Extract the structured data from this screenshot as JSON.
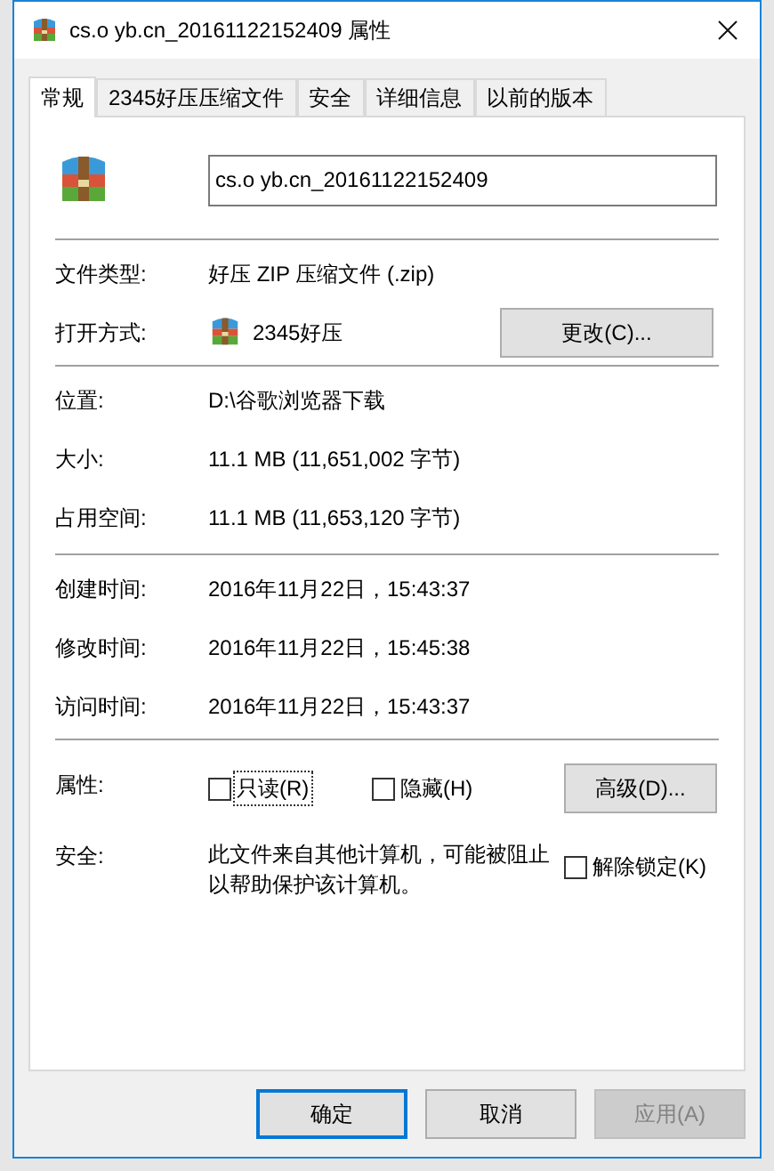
{
  "window": {
    "title": "cs.o yb.cn_20161122152409 属性"
  },
  "tabs": [
    {
      "label": "常规",
      "selected": true
    },
    {
      "label": "2345好压压缩文件",
      "selected": false
    },
    {
      "label": "安全",
      "selected": false
    },
    {
      "label": "详细信息",
      "selected": false
    },
    {
      "label": "以前的版本",
      "selected": false
    }
  ],
  "file_name": {
    "value": "cs.o yb.cn_20161122152409"
  },
  "type_rows": [
    {
      "kind": "text",
      "label": "文件类型:",
      "value": "好压 ZIP 压缩文件 (.zip)"
    },
    {
      "kind": "app",
      "label": "打开方式:",
      "value": "2345好压",
      "button": "更改(C)..."
    }
  ],
  "location_rows": [
    {
      "label": "位置:",
      "value": "D:\\谷歌浏览器下载"
    },
    {
      "label": "大小:",
      "value": "11.1 MB (11,651,002 字节)"
    },
    {
      "label": "占用空间:",
      "value": "11.1 MB (11,653,120 字节)"
    }
  ],
  "time_rows": [
    {
      "label": "创建时间:",
      "value": "2016年11月22日，15:43:37"
    },
    {
      "label": "修改时间:",
      "value": "2016年11月22日，15:45:38"
    },
    {
      "label": "访问时间:",
      "value": "2016年11月22日，15:43:37"
    }
  ],
  "attributes": {
    "label": "属性:",
    "checkboxes": [
      {
        "label": "只读(R)",
        "checked": false,
        "focused": true
      },
      {
        "label": "隐藏(H)",
        "checked": false,
        "focused": false
      }
    ],
    "button": "高级(D)..."
  },
  "security": {
    "label": "安全:",
    "text": "此文件来自其他计算机，可能被阻止以帮助保护该计算机。",
    "checkbox": {
      "label": "解除锁定(K)",
      "checked": false
    }
  },
  "buttons": [
    {
      "label": "确定",
      "kind": "default"
    },
    {
      "label": "取消",
      "kind": "normal"
    },
    {
      "label": "应用(A)",
      "kind": "disabled"
    }
  ]
}
